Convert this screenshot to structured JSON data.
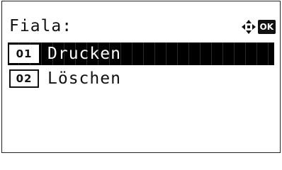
{
  "screen": {
    "title": "Fiala:",
    "ok_label": "OK"
  },
  "menu": {
    "items": [
      {
        "number": "01",
        "label": "Drucken",
        "selected": true
      },
      {
        "number": "02",
        "label": "Löschen",
        "selected": false
      }
    ]
  },
  "icons": {
    "nav": "arrow-keys-icon",
    "ok": "ok-key-icon"
  }
}
